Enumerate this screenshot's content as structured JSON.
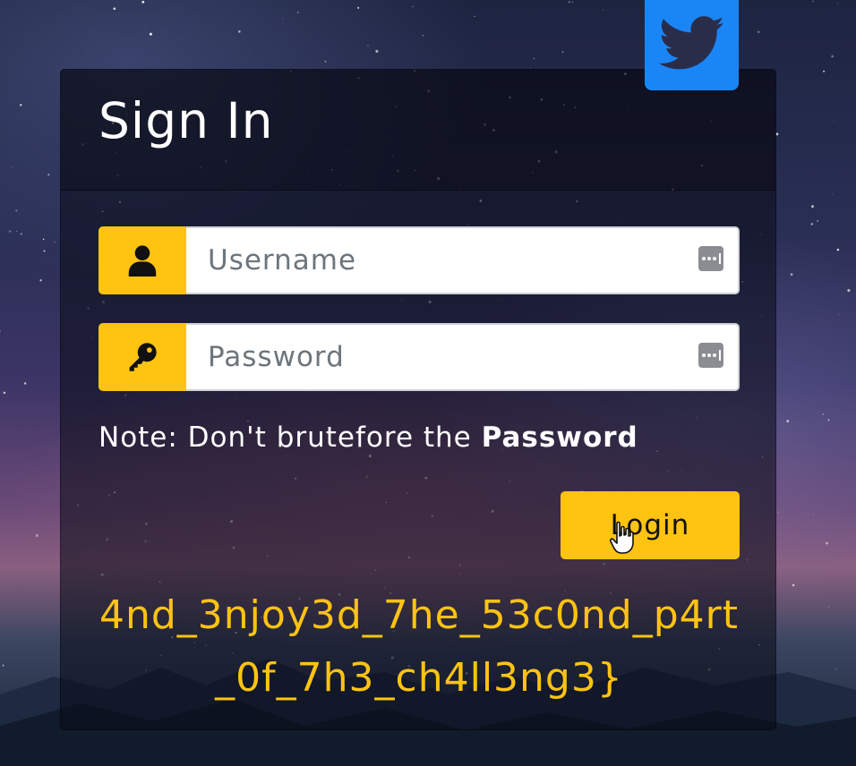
{
  "login_form": {
    "title": "Sign In",
    "username": {
      "placeholder": "Username",
      "value": ""
    },
    "password": {
      "placeholder": "Password",
      "value": ""
    },
    "note_prefix": "Note: Don't brutefore the ",
    "note_bold": "Password",
    "login_label": "Login",
    "flag_text": "4nd_3njoy3d_7he_53c0nd_p4rt_0f_7h3_ch4ll3ng3}"
  },
  "icons": {
    "social": "twitter-icon",
    "username_addon": "user-icon",
    "password_addon": "key-icon",
    "field_helper": "password-manager-icon",
    "pointer": "hand-cursor-icon"
  },
  "colors": {
    "accent": "#ffc312",
    "twitter": "#1a86f6",
    "card_bg": "rgba(10,12,24,0.58)",
    "text": "#ffffff"
  }
}
